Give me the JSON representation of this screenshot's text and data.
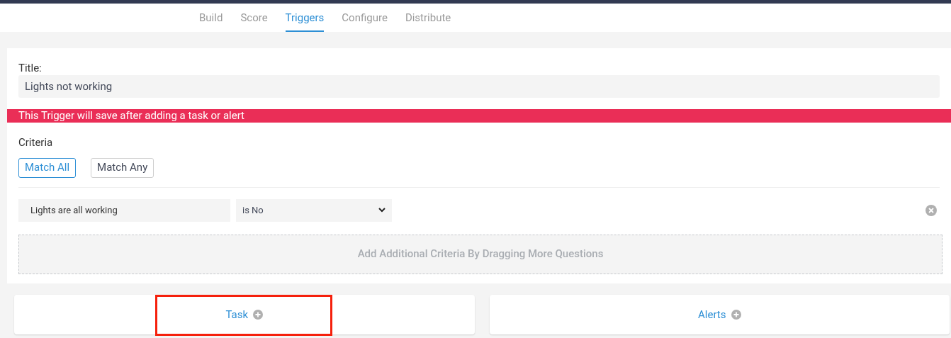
{
  "tabs": [
    {
      "label": "Build",
      "selected": false
    },
    {
      "label": "Score",
      "selected": false
    },
    {
      "label": "Triggers",
      "selected": true
    },
    {
      "label": "Configure",
      "selected": false
    },
    {
      "label": "Distribute",
      "selected": false
    }
  ],
  "title_field": {
    "label": "Title:",
    "value": "Lights not working"
  },
  "warning_banner": "This Trigger will save after adding a task or alert",
  "criteria": {
    "heading": "Criteria",
    "match_buttons": [
      {
        "label": "Match All",
        "selected": true
      },
      {
        "label": "Match Any",
        "selected": false
      }
    ],
    "rows": [
      {
        "question": "Lights are all working",
        "condition": "is No"
      }
    ],
    "drop_zone": "Add Additional Criteria By Dragging More Questions"
  },
  "actions": [
    {
      "label": "Task",
      "highlighted": true
    },
    {
      "label": "Alerts",
      "highlighted": false
    }
  ]
}
